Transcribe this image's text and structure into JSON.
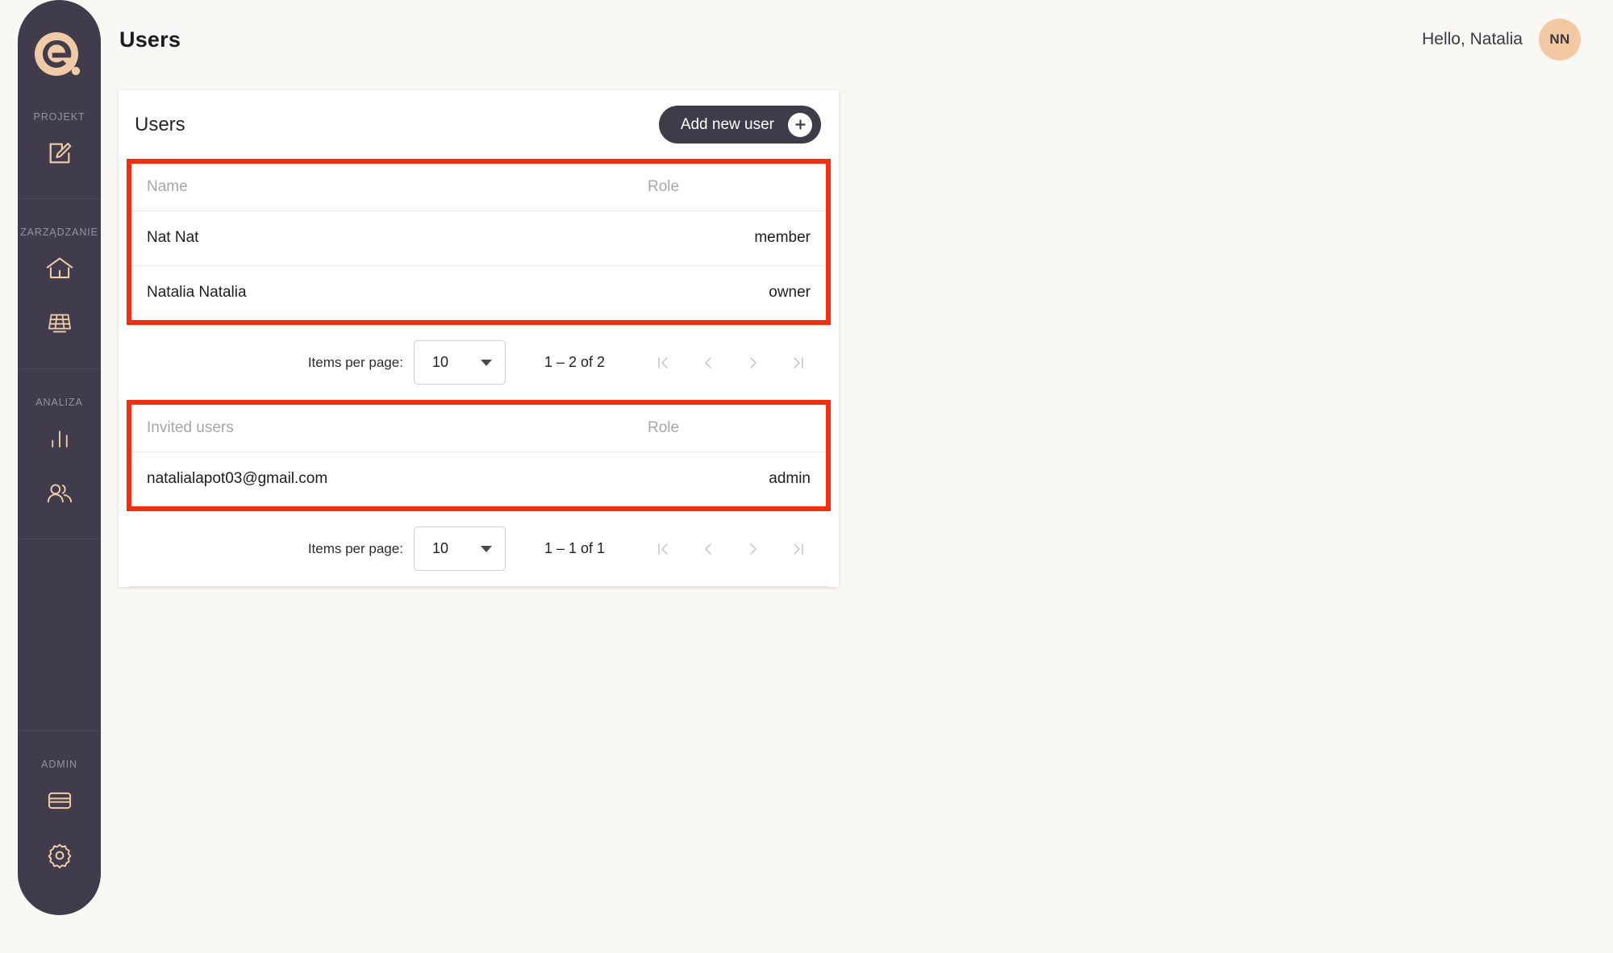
{
  "brand": {
    "logo_letter": "e",
    "accent_color": "#f0cba6",
    "sidebar_color": "#403c4c"
  },
  "sidebar": {
    "sections": [
      {
        "label": "PROJEKT",
        "items": [
          {
            "icon": "edit-document-icon",
            "name": "sidebar-item-projekt-edit"
          }
        ]
      },
      {
        "label": "ZARZĄDZANIE",
        "items": [
          {
            "icon": "home-icon",
            "name": "sidebar-item-home"
          },
          {
            "icon": "solar-panel-icon",
            "name": "sidebar-item-panels"
          }
        ]
      },
      {
        "label": "ANALIZA",
        "items": [
          {
            "icon": "bar-chart-icon",
            "name": "sidebar-item-analytics"
          },
          {
            "icon": "users-icon",
            "name": "sidebar-item-users"
          }
        ]
      },
      {
        "label": "ADMIN",
        "items": [
          {
            "icon": "credit-card-icon",
            "name": "sidebar-item-billing"
          },
          {
            "icon": "gear-icon",
            "name": "sidebar-item-settings"
          }
        ]
      }
    ]
  },
  "header": {
    "title": "Users",
    "greeting": "Hello, Natalia",
    "avatar_initials": "NN"
  },
  "card": {
    "title": "Users",
    "add_button_label": "Add new user",
    "add_button_icon": "plus-icon"
  },
  "users_table": {
    "highlighted": true,
    "highlight_color": "#fa2c0a",
    "columns": [
      "Name",
      "Role"
    ],
    "rows": [
      {
        "name": "Nat Nat",
        "role": "member"
      },
      {
        "name": "Natalia Natalia",
        "role": "owner"
      }
    ]
  },
  "users_paginator": {
    "items_per_page_label": "Items per page:",
    "items_per_page_value": "10",
    "range_label": "1 – 2 of 2",
    "buttons": [
      {
        "name": "first-page-button",
        "glyph": "|<"
      },
      {
        "name": "previous-page-button",
        "glyph": "<"
      },
      {
        "name": "next-page-button",
        "glyph": ">"
      },
      {
        "name": "last-page-button",
        "glyph": ">|"
      }
    ]
  },
  "invited_table": {
    "highlighted": true,
    "highlight_color": "#fa2c0a",
    "columns": [
      "Invited users",
      "Role"
    ],
    "rows": [
      {
        "name": "natalialapot03@gmail.com",
        "role": "admin"
      }
    ]
  },
  "invited_paginator": {
    "items_per_page_label": "Items per page:",
    "items_per_page_value": "10",
    "range_label": "1 – 1 of 1",
    "buttons": [
      {
        "name": "first-page-button",
        "glyph": "|<"
      },
      {
        "name": "previous-page-button",
        "glyph": "<"
      },
      {
        "name": "next-page-button",
        "glyph": ">"
      },
      {
        "name": "last-page-button",
        "glyph": ">|"
      }
    ]
  }
}
